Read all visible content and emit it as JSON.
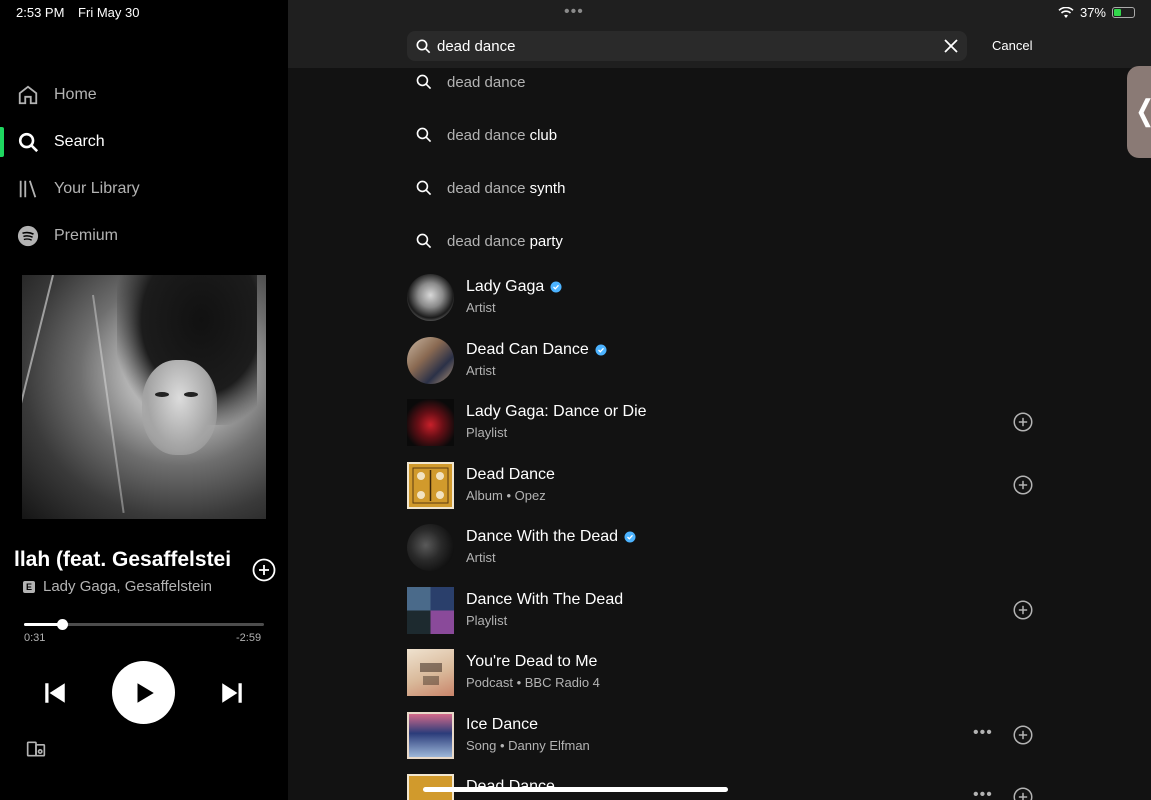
{
  "status_bar": {
    "time": "2:53 PM",
    "date": "Fri May 30",
    "battery_percent": "37%",
    "battery_level": 0.37
  },
  "sidebar": {
    "nav": [
      {
        "label": "Home",
        "icon": "home-icon"
      },
      {
        "label": "Search",
        "icon": "search-icon",
        "active": true
      },
      {
        "label": "Your Library",
        "icon": "library-icon"
      },
      {
        "label": "Premium",
        "icon": "spotify-icon"
      }
    ]
  },
  "now_playing": {
    "title": "llah (feat. Gesaffelstei",
    "explicit_badge": "E",
    "artists": "Lady Gaga, Gesaffelstein",
    "elapsed": "0:31",
    "remaining": "-2:59",
    "progress": 0.16
  },
  "search": {
    "query": "dead dance",
    "cancel_label": "Cancel"
  },
  "suggestions": [
    {
      "prefix": "dead dance",
      "suffix": ""
    },
    {
      "prefix": "dead dance",
      "suffix": " club"
    },
    {
      "prefix": "dead dance",
      "suffix": " synth"
    },
    {
      "prefix": "dead dance",
      "suffix": " party"
    }
  ],
  "results": [
    {
      "title": "Lady Gaga",
      "subtitle": "Artist",
      "verified": true
    },
    {
      "title": "Dead Can Dance",
      "subtitle": "Artist",
      "verified": true
    },
    {
      "title": "Lady Gaga: Dance or Die",
      "subtitle": "Playlist"
    },
    {
      "title": "Dead Dance",
      "subtitle": "Album • Opez"
    },
    {
      "title": "Dance With the Dead",
      "subtitle": "Artist",
      "verified": true
    },
    {
      "title": "Dance With The Dead",
      "subtitle": "Playlist"
    },
    {
      "title": "You're Dead to Me",
      "subtitle": "Podcast • BBC Radio 4"
    },
    {
      "title": "Ice Dance",
      "subtitle": "Song • Danny Elfman"
    },
    {
      "title": "Dead Dance",
      "subtitle": ""
    }
  ],
  "colors": {
    "accent": "#1ed760",
    "verified": "#4cb3ff",
    "background": "#121212",
    "sidebar": "#000000"
  }
}
